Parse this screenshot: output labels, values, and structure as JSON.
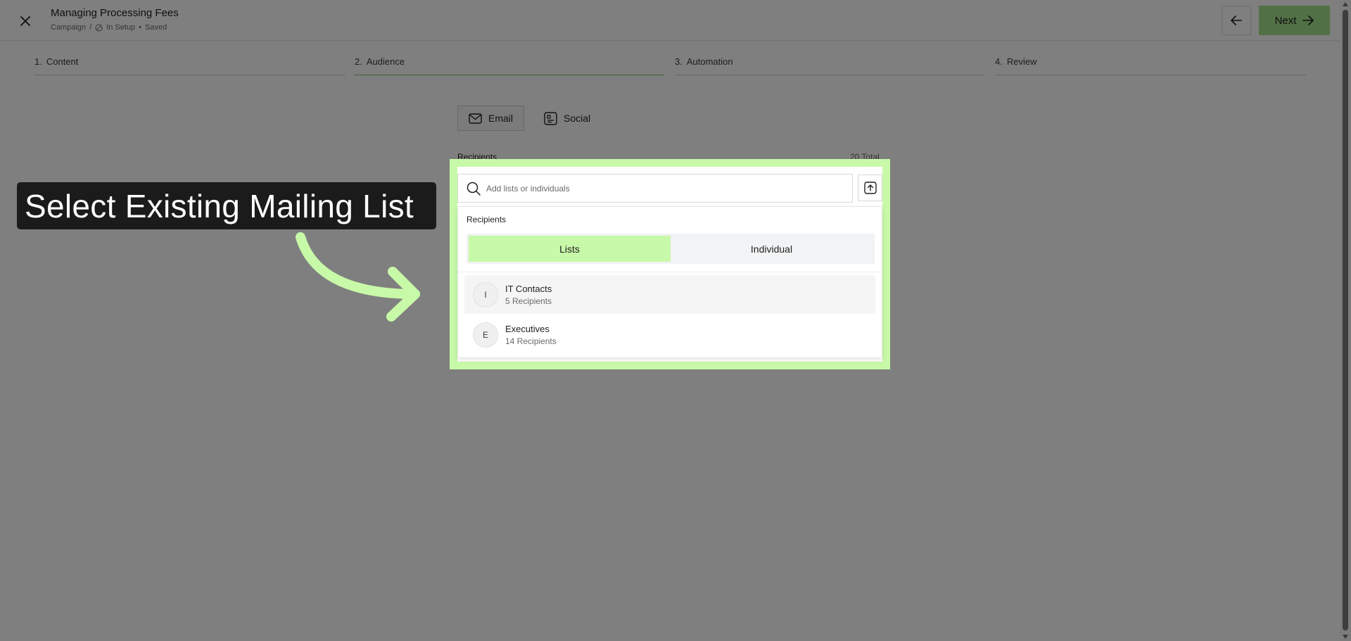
{
  "header": {
    "title": "Managing Processing Fees",
    "breadcrumb": "Campaign",
    "breadcrumb_sep": "/",
    "status": "In Setup",
    "status_sep": "•",
    "saved": "Saved",
    "next_label": "Next"
  },
  "steps": [
    {
      "num": "1.",
      "label": "Content"
    },
    {
      "num": "2.",
      "label": "Audience"
    },
    {
      "num": "3.",
      "label": "Automation"
    },
    {
      "num": "4.",
      "label": "Review"
    }
  ],
  "channels": {
    "email": "Email",
    "social": "Social"
  },
  "recipients": {
    "label": "Recipients",
    "total": "20 Total"
  },
  "search": {
    "placeholder": "Add lists or individuals"
  },
  "dropdown": {
    "title": "Recipients",
    "tab_lists": "Lists",
    "tab_individual": "Individual",
    "items": [
      {
        "initial": "I",
        "name": "IT Contacts",
        "count": "5 Recipients"
      },
      {
        "initial": "E",
        "name": "Executives",
        "count": "14 Recipients"
      }
    ]
  },
  "callout": {
    "text": "Select Existing Mailing List"
  },
  "colors": {
    "highlight": "#c8f9a8",
    "next_button": "#a4e08b",
    "callout_bg": "#1b1b1b"
  }
}
